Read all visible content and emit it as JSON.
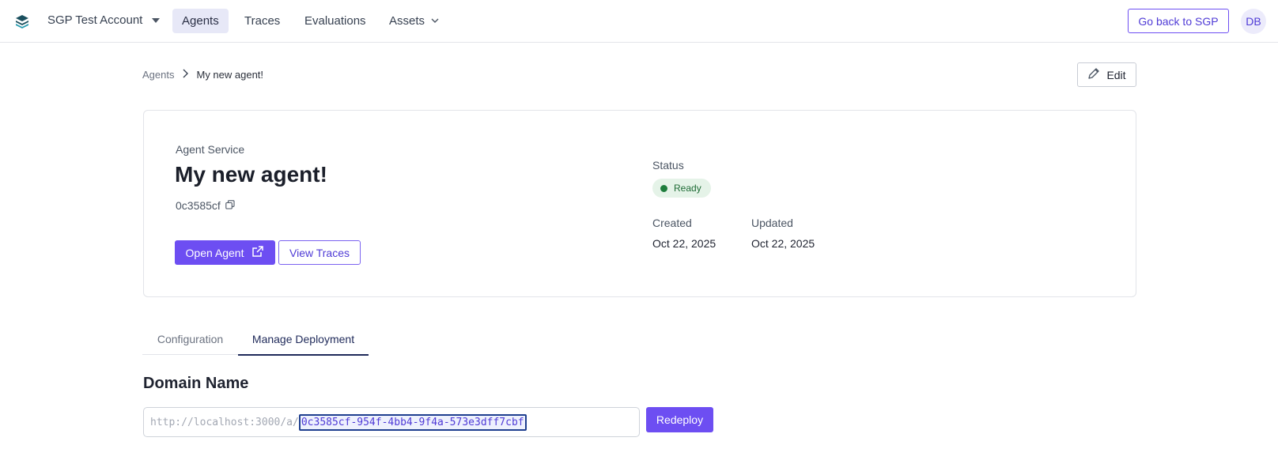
{
  "nav": {
    "account": "SGP Test Account",
    "tabs": [
      {
        "label": "Agents"
      },
      {
        "label": "Traces"
      },
      {
        "label": "Evaluations"
      },
      {
        "label": "Assets"
      }
    ],
    "go_back": "Go back to SGP",
    "avatar_initials": "DB"
  },
  "breadcrumb": {
    "root": "Agents",
    "current": "My new agent!"
  },
  "edit_label": "Edit",
  "agent": {
    "service_label": "Agent Service",
    "name": "My new agent!",
    "short_id": "0c3585cf",
    "open_label": "Open Agent",
    "traces_label": "View Traces",
    "status_label": "Status",
    "status": "Ready",
    "created_label": "Created",
    "created": "Oct 22, 2025",
    "updated_label": "Updated",
    "updated": "Oct 22, 2025"
  },
  "tabs": {
    "configuration": "Configuration",
    "manage": "Manage Deployment"
  },
  "domain": {
    "title": "Domain Name",
    "prefix": "http://localhost:3000/a/",
    "slug": "0c3585cf-954f-4bb4-9f4a-573e3dff7cbf",
    "redeploy": "Redeploy"
  },
  "colors": {
    "accent": "#6d4ef2",
    "status_green": "#1e7d3c"
  }
}
